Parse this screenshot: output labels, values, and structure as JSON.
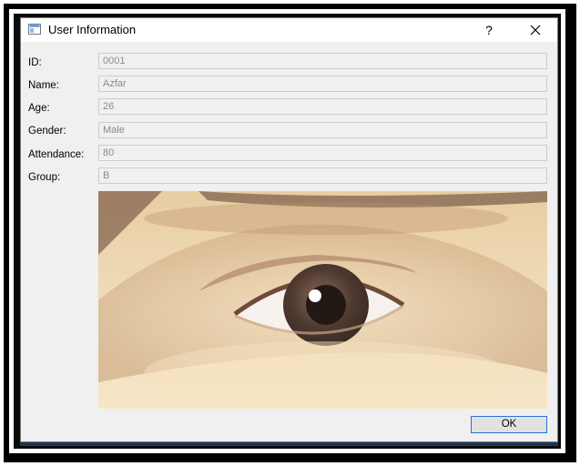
{
  "window": {
    "title": "User Information",
    "help_label": "?",
    "close_icon": "close-icon"
  },
  "fields": [
    {
      "label": "ID:",
      "value": "0001"
    },
    {
      "label": "Name:",
      "value": "Azfar"
    },
    {
      "label": "Age:",
      "value": "26"
    },
    {
      "label": "Gender:",
      "value": "Male"
    },
    {
      "label": "Attendance:",
      "value": "80"
    },
    {
      "label": "Group:",
      "value": "B"
    }
  ],
  "photo": {
    "icon": "eye-photo"
  },
  "buttons": {
    "ok_label": "OK"
  },
  "colors": {
    "dialog_bg": "#f0f0f0",
    "ok_border": "#2f6fd0",
    "field_text": "#8a8a8a"
  }
}
